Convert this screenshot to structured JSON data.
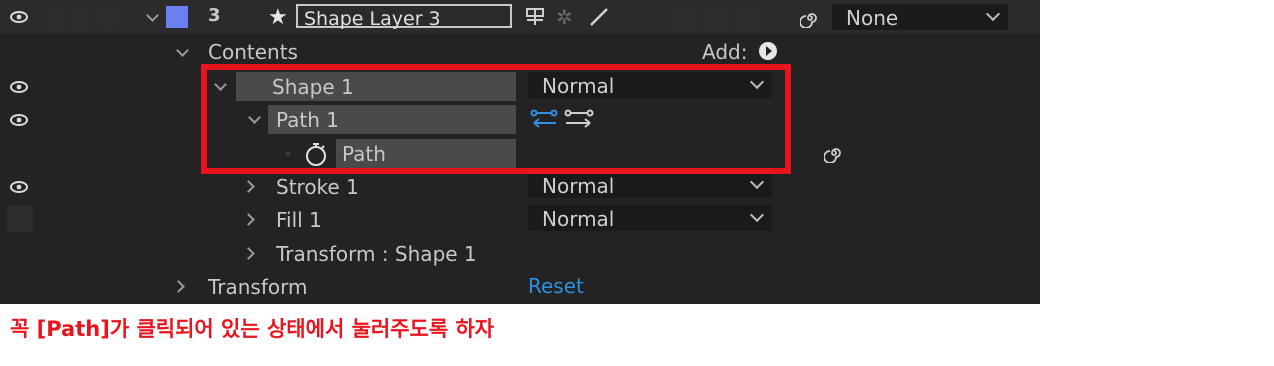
{
  "layer": {
    "number": "3",
    "name": "Shape Layer 3",
    "parent_value": "None"
  },
  "contents": {
    "label": "Contents",
    "add_label": "Add:"
  },
  "shape1": {
    "label": "Shape 1",
    "blend_mode": "Normal"
  },
  "path1": {
    "label": "Path 1"
  },
  "path": {
    "label": "Path"
  },
  "stroke1": {
    "label": "Stroke 1",
    "blend_mode": "Normal"
  },
  "fill1": {
    "label": "Fill 1",
    "blend_mode": "Normal"
  },
  "transform_shape": {
    "label": "Transform : Shape 1"
  },
  "transform": {
    "label": "Transform",
    "reset_label": "Reset"
  },
  "caption": "꼭 [Path]가 클릭되어 있는 상태에서 눌러주도록 하자",
  "colors": {
    "highlight": "#e8151e",
    "label_color": "#6b7ff0",
    "link_blue": "#2f8fe0"
  }
}
